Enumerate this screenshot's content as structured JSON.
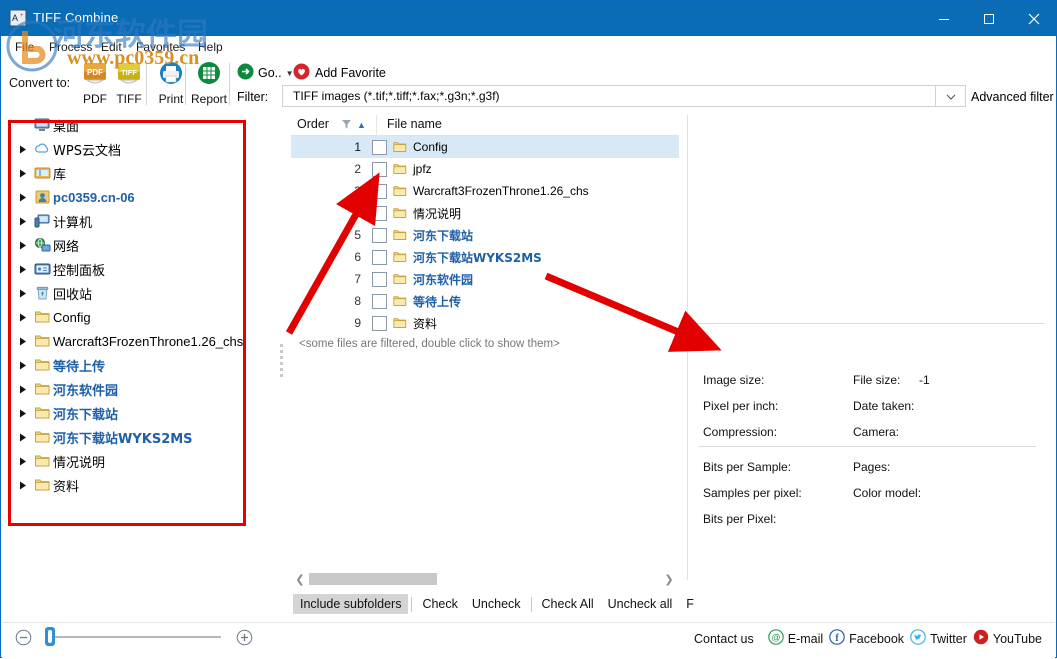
{
  "window": {
    "title": "TIFF Combine",
    "icon": "app-icon",
    "minimize": "–",
    "maximize": "□",
    "close": "✕"
  },
  "watermark": {
    "cn": "河东软件园",
    "url": "www.pc0359.cn"
  },
  "menu": {
    "items": [
      {
        "label": "File"
      },
      {
        "label": "Process"
      },
      {
        "label": "Edit"
      },
      {
        "label": "Favorites"
      },
      {
        "label": "Help"
      }
    ]
  },
  "toolbar": {
    "convert_to_label": "Convert to:",
    "buttons": [
      {
        "label": "PDF",
        "icon": "pdf-icon"
      },
      {
        "label": "TIFF",
        "icon": "tiff-icon"
      },
      {
        "label": "Print",
        "icon": "printer-icon"
      },
      {
        "label": "Report",
        "icon": "report-icon"
      }
    ],
    "go_label": "Go..",
    "add_favorite_label": "Add Favorite",
    "filter_label": "Filter:",
    "filter_value": "TIFF images (*.tif;*.tiff;*.fax;*.g3n;*.g3f)",
    "advanced_filter_label": "Advanced filter"
  },
  "tree": {
    "items": [
      {
        "label": "桌面",
        "icon": "desktop-icon",
        "expandable": false,
        "style": "cn",
        "indent": 0
      },
      {
        "label": "WPS云文档",
        "icon": "cloud-icon",
        "expandable": true,
        "style": "cn",
        "indent": 1
      },
      {
        "label": "库",
        "icon": "library-icon",
        "expandable": true,
        "style": "cn",
        "indent": 1
      },
      {
        "label": "pc0359.cn-06",
        "icon": "user-icon",
        "expandable": true,
        "style": "blue",
        "indent": 1
      },
      {
        "label": "计算机",
        "icon": "computer-icon",
        "expandable": true,
        "style": "cn",
        "indent": 1
      },
      {
        "label": "网络",
        "icon": "network-icon",
        "expandable": true,
        "style": "cn",
        "indent": 1
      },
      {
        "label": "控制面板",
        "icon": "control-panel-icon",
        "expandable": true,
        "style": "cn",
        "indent": 1
      },
      {
        "label": "回收站",
        "icon": "recycle-bin-icon",
        "expandable": true,
        "style": "cn",
        "indent": 1
      },
      {
        "label": "Config",
        "icon": "folder-icon",
        "expandable": true,
        "style": "plain",
        "indent": 1
      },
      {
        "label": "Warcraft3FrozenThrone1.26_chs",
        "icon": "folder-icon",
        "expandable": true,
        "style": "plain",
        "indent": 1
      },
      {
        "label": "等待上传",
        "icon": "folder-icon",
        "expandable": true,
        "style": "blue",
        "indent": 1
      },
      {
        "label": "河东软件园",
        "icon": "folder-icon",
        "expandable": true,
        "style": "blue",
        "indent": 1
      },
      {
        "label": "河东下载站",
        "icon": "folder-icon",
        "expandable": true,
        "style": "blue",
        "indent": 1
      },
      {
        "label": "河东下载站WYKS2MS",
        "icon": "folder-icon",
        "expandable": true,
        "style": "blue",
        "indent": 1
      },
      {
        "label": "情况说明",
        "icon": "folder-icon",
        "expandable": true,
        "style": "cn",
        "indent": 1
      },
      {
        "label": "资料",
        "icon": "folder-icon",
        "expandable": true,
        "style": "cn",
        "indent": 1
      }
    ]
  },
  "filelist": {
    "columns": {
      "order": "Order",
      "filename": "File name"
    },
    "sort_direction": "ascending",
    "rows": [
      {
        "num": "1",
        "name": "Config",
        "checked": false,
        "selected": true,
        "style": "plain"
      },
      {
        "num": "2",
        "name": "jpfz",
        "checked": false,
        "selected": false,
        "style": "plain"
      },
      {
        "num": "3",
        "name": "Warcraft3FrozenThrone1.26_chs",
        "checked": false,
        "selected": false,
        "style": "plain"
      },
      {
        "num": "",
        "name": "情况说明",
        "checked": false,
        "selected": false,
        "style": "cn"
      },
      {
        "num": "5",
        "name": "河东下载站",
        "checked": false,
        "selected": false,
        "style": "blue"
      },
      {
        "num": "6",
        "name": "河东下载站WYKS2MS",
        "checked": false,
        "selected": false,
        "style": "blue"
      },
      {
        "num": "7",
        "name": "河东软件园",
        "checked": false,
        "selected": false,
        "style": "blue"
      },
      {
        "num": "8",
        "name": "等待上传",
        "checked": false,
        "selected": false,
        "style": "blue"
      },
      {
        "num": "9",
        "name": "资料",
        "checked": false,
        "selected": false,
        "style": "cn"
      }
    ],
    "filtered_note": "<some files are filtered, double click to show them>"
  },
  "listbuttons": {
    "include_subfolders": "Include subfolders",
    "check": "Check",
    "uncheck": "Uncheck",
    "check_all": "Check All",
    "uncheck_all": "Uncheck all",
    "more": "F"
  },
  "info": {
    "image_size_label": "Image size:",
    "image_size_value": "",
    "file_size_label": "File size:",
    "file_size_value": "-1",
    "ppi_label": "Pixel per inch:",
    "ppi_value": "",
    "date_taken_label": "Date taken:",
    "date_taken_value": "",
    "compression_label": "Compression:",
    "compression_value": "",
    "camera_label": "Camera:",
    "camera_value": "",
    "bits_per_sample_label": "Bits per Sample:",
    "bits_per_sample_value": "",
    "pages_label": "Pages:",
    "pages_value": "",
    "samples_per_pixel_label": "Samples per pixel:",
    "samples_per_pixel_value": "",
    "color_model_label": "Color model:",
    "color_model_value": "",
    "bits_per_pixel_label": "Bits per Pixel:",
    "bits_per_pixel_value": ""
  },
  "statusbar": {
    "zoom_out": "⊖",
    "zoom_in": "⊕",
    "contact_us": "Contact us",
    "links": [
      {
        "label": "E-mail",
        "icon": "email-icon"
      },
      {
        "label": "Facebook",
        "icon": "facebook-icon"
      },
      {
        "label": "Twitter",
        "icon": "twitter-icon"
      },
      {
        "label": "YouTube",
        "icon": "youtube-icon"
      }
    ]
  },
  "colors": {
    "titlebar": "#0a6cb4",
    "selection": "#d7e9f7",
    "annotation_red": "#e60000",
    "blue_text": "#1f5fa8"
  }
}
